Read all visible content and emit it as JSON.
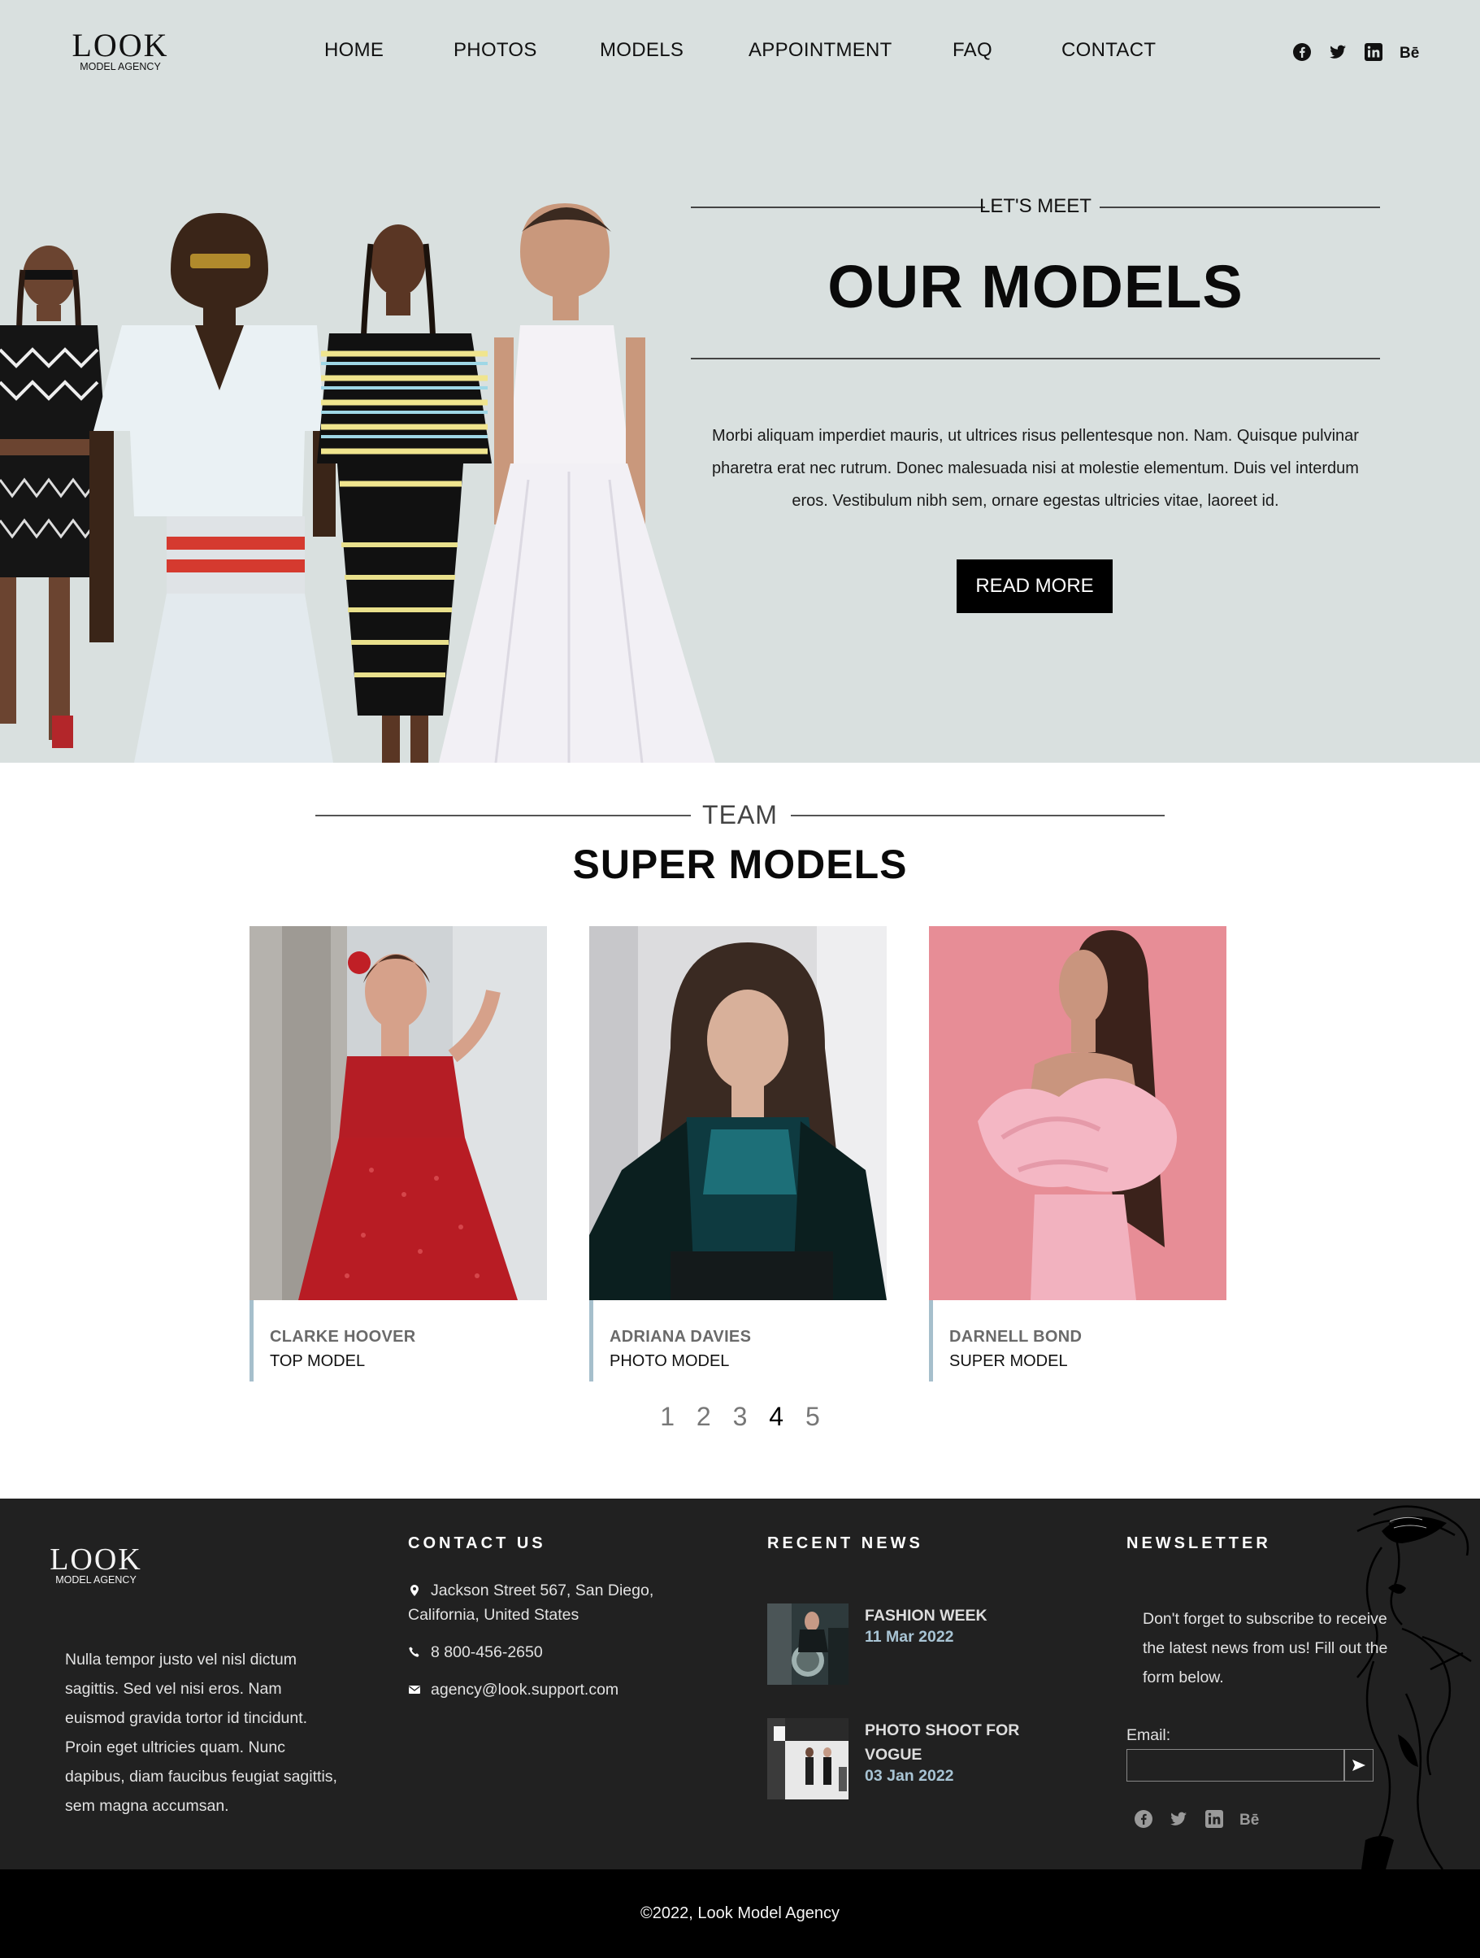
{
  "brand": {
    "logo_main": "LOOK",
    "logo_sub": "MODEL AGENCY"
  },
  "nav": {
    "items": [
      {
        "label": "HOME"
      },
      {
        "label": "PHOTOS"
      },
      {
        "label": "MODELS"
      },
      {
        "label": "APPOINTMENT"
      },
      {
        "label": "FAQ"
      },
      {
        "label": "CONTACT"
      }
    ]
  },
  "social": [
    "facebook-icon",
    "twitter-icon",
    "linkedin-icon",
    "behance-icon"
  ],
  "hero": {
    "eyebrow": "LET'S MEET",
    "title": "OUR MODELS",
    "description": "Morbi aliquam imperdiet mauris, ut ultrices risus pellentesque non. Nam. Quisque pulvinar pharetra erat nec rutrum. Donec malesuada nisi at molestie elementum. Duis vel interdum eros. Vestibulum nibh sem, ornare egestas ultricies vitae, laoreet id.",
    "button": "READ MORE"
  },
  "team": {
    "eyebrow": "TEAM",
    "title": "SUPER MODELS",
    "members": [
      {
        "name": "CLARKE HOOVER",
        "role": "TOP MODEL"
      },
      {
        "name": "ADRIANA DAVIES",
        "role": "PHOTO MODEL"
      },
      {
        "name": "DARNELL BOND",
        "role": "SUPER MODEL"
      }
    ],
    "pages": [
      "1",
      "2",
      "3",
      "4",
      "5"
    ],
    "active_page": "4"
  },
  "footer": {
    "about": "Nulla tempor justo vel nisl dictum sagittis. Sed vel nisi eros. Nam euismod gravida tortor id tincidunt. Proin eget ultricies quam. Nunc dapibus, diam faucibus feugiat sagittis, sem magna accumsan.",
    "contact": {
      "heading": "CONTACT US",
      "address": "Jackson Street 567, San Diego, California, United States",
      "phone": "8 800-456-2650",
      "email": "agency@look.support.com"
    },
    "news": {
      "heading": "RECENT NEWS",
      "items": [
        {
          "title": "FASHION WEEK",
          "date": "11 Mar 2022"
        },
        {
          "title": "PHOTO SHOOT FOR VOGUE",
          "date": "03 Jan 2022"
        }
      ]
    },
    "newsletter": {
      "heading": "NEWSLETTER",
      "text": "Don't forget to subscribe to receive the latest news from us! Fill out the form below.",
      "email_label": "Email:",
      "email_value": "",
      "submit_icon": "send-icon"
    }
  },
  "copyright": "©2022, Look Model Agency",
  "colors": {
    "hero_bg": "#d9e0df",
    "footer_bg": "#212121",
    "accent": "#a6bfcc",
    "news_date": "#a8c4d4",
    "copyright_bg": "#000000"
  }
}
